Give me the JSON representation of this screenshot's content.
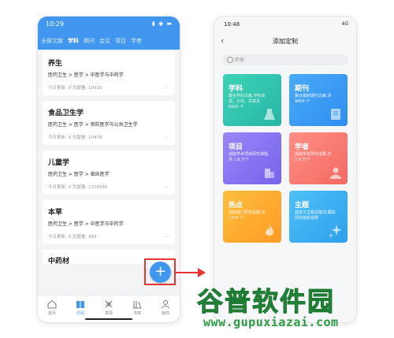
{
  "left_phone": {
    "status_time": "10:29",
    "tabs": [
      {
        "label": "全部文献"
      },
      {
        "label": "学科"
      },
      {
        "label": "期刊"
      },
      {
        "label": "会议"
      },
      {
        "label": "项目"
      },
      {
        "label": "学者"
      }
    ],
    "cards": [
      {
        "title": "养生",
        "path": "医药卫生 > 医学 > 中医学与中药学",
        "meta": "今日更新: 0  文献量: 10919"
      },
      {
        "title": "食品卫生学",
        "path": "医药卫生 > 医学 > 预防医学与公共卫生学",
        "meta": "今日更新: 0  文献量: 10478"
      },
      {
        "title": "儿童学",
        "path": "医药卫生 > 医学 > 临床医学",
        "meta": "今日更新: 0  文献量: 1376585"
      },
      {
        "title": "本草",
        "path": "医药卫生 > 医学 > 中医学与中药学",
        "meta": "今日更新: 0  文献量: 493"
      }
    ],
    "partial_card_title": "中药材",
    "tabbar": [
      {
        "label": "首页",
        "icon": "home-icon"
      },
      {
        "label": "订阅",
        "icon": "book-icon"
      },
      {
        "label": "发现",
        "icon": "discover-icon"
      },
      {
        "label": "书架",
        "icon": "bookshelf-icon"
      },
      {
        "label": "我的",
        "icon": "user-icon"
      }
    ],
    "fab_label": "+"
  },
  "right_phone": {
    "status_time": "10:48",
    "status_right": "4G",
    "back_symbol": "‹",
    "title": "添加定制",
    "search_placeholder": "检索",
    "tiles": [
      {
        "title": "学科",
        "desc": "聚合学科文献,学科资源、订阅、共享及 6930 个",
        "color": "#2ec4ae",
        "icon": "flask-icon"
      },
      {
        "title": "期刊",
        "desc": "聚合最新期刊文献,共 9800 个",
        "color": "#3a9cf4",
        "icon": "journal-icon"
      },
      {
        "title": "项目",
        "desc": "追踪学术项目研究课题,共 1.6 万个",
        "color": "#8572f1",
        "icon": "building-icon"
      },
      {
        "title": "学者",
        "desc": "追踪学者研究成果,共 2.8 万个",
        "color": "#f47b73",
        "icon": "scholar-icon"
      },
      {
        "title": "热点",
        "desc": "追踪热门研究话题,共 1245 个",
        "color": "#feab30",
        "icon": "flame-icon"
      },
      {
        "title": "主题",
        "desc": "自定义主题关键词,跟踪研究最新成果",
        "color": "#36aef2",
        "icon": "sparkle-icon"
      }
    ]
  },
  "watermark": {
    "logo_text": "谷普软件园",
    "url": "www.gupuxiazai.com"
  },
  "colors": {
    "primary": "#4196f0",
    "highlight": "#e8352e",
    "watermark": "#2f9b47"
  }
}
